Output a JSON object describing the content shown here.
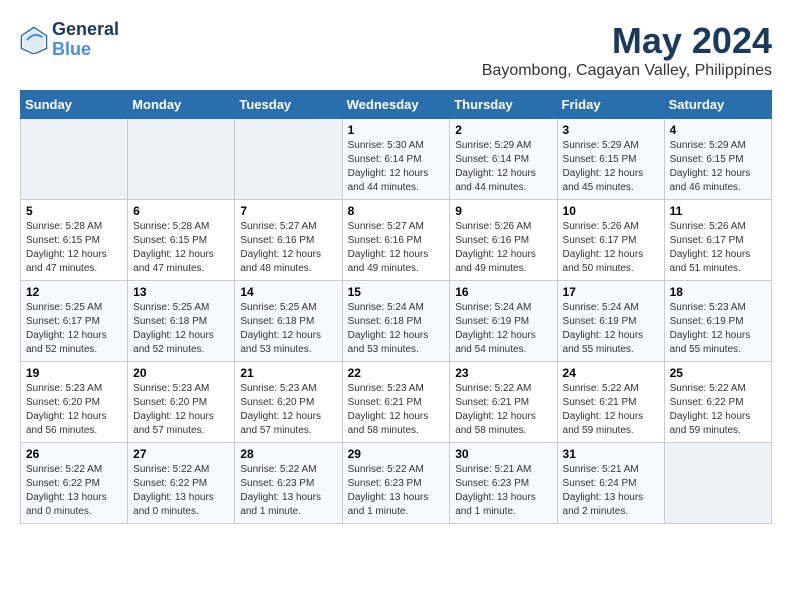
{
  "logo": {
    "line1": "General",
    "line2": "Blue"
  },
  "title": "May 2024",
  "subtitle": "Bayombong, Cagayan Valley, Philippines",
  "days_header": [
    "Sunday",
    "Monday",
    "Tuesday",
    "Wednesday",
    "Thursday",
    "Friday",
    "Saturday"
  ],
  "weeks": [
    [
      {
        "day": "",
        "info": ""
      },
      {
        "day": "",
        "info": ""
      },
      {
        "day": "",
        "info": ""
      },
      {
        "day": "1",
        "info": "Sunrise: 5:30 AM\nSunset: 6:14 PM\nDaylight: 12 hours\nand 44 minutes."
      },
      {
        "day": "2",
        "info": "Sunrise: 5:29 AM\nSunset: 6:14 PM\nDaylight: 12 hours\nand 44 minutes."
      },
      {
        "day": "3",
        "info": "Sunrise: 5:29 AM\nSunset: 6:15 PM\nDaylight: 12 hours\nand 45 minutes."
      },
      {
        "day": "4",
        "info": "Sunrise: 5:29 AM\nSunset: 6:15 PM\nDaylight: 12 hours\nand 46 minutes."
      }
    ],
    [
      {
        "day": "5",
        "info": "Sunrise: 5:28 AM\nSunset: 6:15 PM\nDaylight: 12 hours\nand 47 minutes."
      },
      {
        "day": "6",
        "info": "Sunrise: 5:28 AM\nSunset: 6:15 PM\nDaylight: 12 hours\nand 47 minutes."
      },
      {
        "day": "7",
        "info": "Sunrise: 5:27 AM\nSunset: 6:16 PM\nDaylight: 12 hours\nand 48 minutes."
      },
      {
        "day": "8",
        "info": "Sunrise: 5:27 AM\nSunset: 6:16 PM\nDaylight: 12 hours\nand 49 minutes."
      },
      {
        "day": "9",
        "info": "Sunrise: 5:26 AM\nSunset: 6:16 PM\nDaylight: 12 hours\nand 49 minutes."
      },
      {
        "day": "10",
        "info": "Sunrise: 5:26 AM\nSunset: 6:17 PM\nDaylight: 12 hours\nand 50 minutes."
      },
      {
        "day": "11",
        "info": "Sunrise: 5:26 AM\nSunset: 6:17 PM\nDaylight: 12 hours\nand 51 minutes."
      }
    ],
    [
      {
        "day": "12",
        "info": "Sunrise: 5:25 AM\nSunset: 6:17 PM\nDaylight: 12 hours\nand 52 minutes."
      },
      {
        "day": "13",
        "info": "Sunrise: 5:25 AM\nSunset: 6:18 PM\nDaylight: 12 hours\nand 52 minutes."
      },
      {
        "day": "14",
        "info": "Sunrise: 5:25 AM\nSunset: 6:18 PM\nDaylight: 12 hours\nand 53 minutes."
      },
      {
        "day": "15",
        "info": "Sunrise: 5:24 AM\nSunset: 6:18 PM\nDaylight: 12 hours\nand 53 minutes."
      },
      {
        "day": "16",
        "info": "Sunrise: 5:24 AM\nSunset: 6:19 PM\nDaylight: 12 hours\nand 54 minutes."
      },
      {
        "day": "17",
        "info": "Sunrise: 5:24 AM\nSunset: 6:19 PM\nDaylight: 12 hours\nand 55 minutes."
      },
      {
        "day": "18",
        "info": "Sunrise: 5:23 AM\nSunset: 6:19 PM\nDaylight: 12 hours\nand 55 minutes."
      }
    ],
    [
      {
        "day": "19",
        "info": "Sunrise: 5:23 AM\nSunset: 6:20 PM\nDaylight: 12 hours\nand 56 minutes."
      },
      {
        "day": "20",
        "info": "Sunrise: 5:23 AM\nSunset: 6:20 PM\nDaylight: 12 hours\nand 57 minutes."
      },
      {
        "day": "21",
        "info": "Sunrise: 5:23 AM\nSunset: 6:20 PM\nDaylight: 12 hours\nand 57 minutes."
      },
      {
        "day": "22",
        "info": "Sunrise: 5:23 AM\nSunset: 6:21 PM\nDaylight: 12 hours\nand 58 minutes."
      },
      {
        "day": "23",
        "info": "Sunrise: 5:22 AM\nSunset: 6:21 PM\nDaylight: 12 hours\nand 58 minutes."
      },
      {
        "day": "24",
        "info": "Sunrise: 5:22 AM\nSunset: 6:21 PM\nDaylight: 12 hours\nand 59 minutes."
      },
      {
        "day": "25",
        "info": "Sunrise: 5:22 AM\nSunset: 6:22 PM\nDaylight: 12 hours\nand 59 minutes."
      }
    ],
    [
      {
        "day": "26",
        "info": "Sunrise: 5:22 AM\nSunset: 6:22 PM\nDaylight: 13 hours\nand 0 minutes."
      },
      {
        "day": "27",
        "info": "Sunrise: 5:22 AM\nSunset: 6:22 PM\nDaylight: 13 hours\nand 0 minutes."
      },
      {
        "day": "28",
        "info": "Sunrise: 5:22 AM\nSunset: 6:23 PM\nDaylight: 13 hours\nand 1 minute."
      },
      {
        "day": "29",
        "info": "Sunrise: 5:22 AM\nSunset: 6:23 PM\nDaylight: 13 hours\nand 1 minute."
      },
      {
        "day": "30",
        "info": "Sunrise: 5:21 AM\nSunset: 6:23 PM\nDaylight: 13 hours\nand 1 minute."
      },
      {
        "day": "31",
        "info": "Sunrise: 5:21 AM\nSunset: 6:24 PM\nDaylight: 13 hours\nand 2 minutes."
      },
      {
        "day": "",
        "info": ""
      }
    ]
  ]
}
